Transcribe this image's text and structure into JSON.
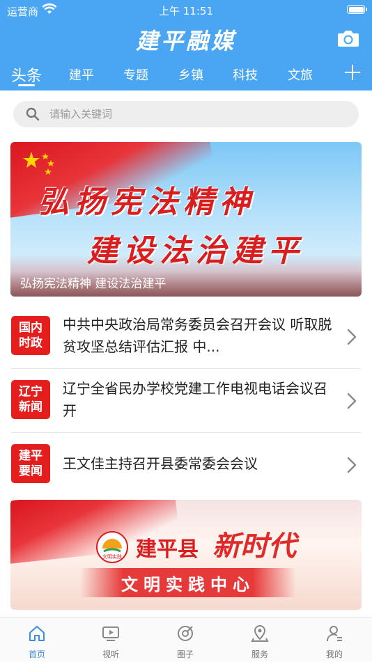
{
  "status_bar": {
    "carrier": "运营商",
    "time": "上午 11:51"
  },
  "header": {
    "app_title": "建平融媒",
    "camera_icon": "camera-icon"
  },
  "tabs": [
    {
      "label": "头条",
      "active": true
    },
    {
      "label": "建平"
    },
    {
      "label": "专题"
    },
    {
      "label": "乡镇"
    },
    {
      "label": "科技"
    },
    {
      "label": "文旅"
    }
  ],
  "search": {
    "placeholder": "请输入关键词",
    "icon": "search-icon"
  },
  "banner": {
    "slogan_line1": "弘扬宪法精神",
    "slogan_line2": "建设法治建平",
    "caption": "弘扬宪法精神 建设法治建平",
    "slide_count": 8,
    "active_slide": 3
  },
  "news": [
    {
      "tag_line1": "国内",
      "tag_line2": "时政",
      "title": "中共中央政治局常务委员会召开会议 听取脱贫攻坚总结评估汇报 中..."
    },
    {
      "tag_line1": "辽宁",
      "tag_line2": "新闻",
      "title": "辽宁全省民办学校党建工作电视电话会议召开"
    },
    {
      "tag_line1": "建平",
      "tag_line2": "要闻",
      "title": "王文佳主持召开县委常委会会议"
    }
  ],
  "banner2": {
    "county": "建平县",
    "era": "新时代",
    "center": "文明实践中心",
    "logo_text": "文明实践",
    "slide_count": 3,
    "active_slide": 3
  },
  "tabbar": [
    {
      "label": "首页",
      "icon": "home-icon",
      "active": true
    },
    {
      "label": "视听",
      "icon": "tv-icon"
    },
    {
      "label": "圈子",
      "icon": "circle-icon"
    },
    {
      "label": "服务",
      "icon": "location-icon"
    },
    {
      "label": "我的",
      "icon": "user-icon"
    }
  ],
  "colors": {
    "header_blue": "#4aa6f2",
    "tag_red": "#e41d1d",
    "active_blue": "#3a8de0"
  }
}
